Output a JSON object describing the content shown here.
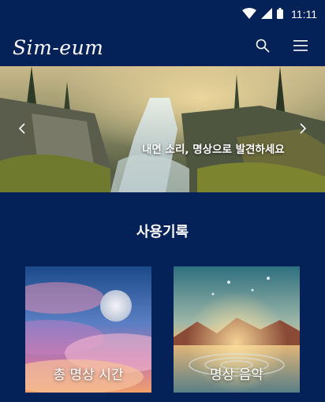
{
  "status_bar": {
    "time": "11:11",
    "icons": [
      "wifi-icon",
      "cell-signal-icon",
      "battery-icon"
    ]
  },
  "app_bar": {
    "logo": "Sim-eum",
    "icons": [
      "search-icon",
      "menu-icon"
    ]
  },
  "hero": {
    "caption": "내면 소리, 명상으로 발견하세요",
    "prev_icon": "chevron-left-icon",
    "next_icon": "chevron-right-icon"
  },
  "usage_section": {
    "title": "사용기록",
    "cards": [
      {
        "label": "총 명상 시간"
      },
      {
        "label": "명상 음악"
      }
    ]
  },
  "colors": {
    "background": "#052258",
    "text": "#ffffff"
  }
}
